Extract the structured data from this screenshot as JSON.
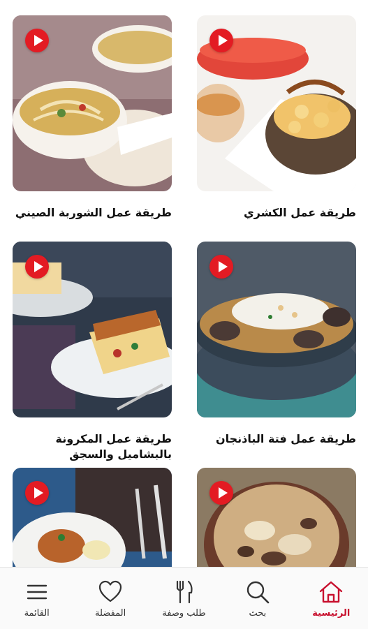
{
  "colors": {
    "accent": "#e31b23",
    "active_nav": "#c8102e",
    "nav_inactive": "#333333"
  },
  "recipes": [
    {
      "title": "طريقة عمل الكشري",
      "image": "koshari-photo",
      "play_icon": "play-icon"
    },
    {
      "title": "طريقة عمل الشوربة الصيني",
      "image": "chinese-soup-photo",
      "play_icon": "play-icon"
    },
    {
      "title": "طريقة عمل فتة الباذنجان",
      "image": "eggplant-fatteh-photo",
      "play_icon": "play-icon"
    },
    {
      "title": "طريقة عمل المكرونة بالبشاميل والسجق",
      "image": "bechamel-pasta-photo",
      "play_icon": "play-icon"
    },
    {
      "title": "",
      "image": "baked-dish-photo",
      "play_icon": "play-icon"
    },
    {
      "title": "",
      "image": "plated-meal-photo",
      "play_icon": "play-icon"
    }
  ],
  "bottom_nav": {
    "items": [
      {
        "label": "الرئيسية",
        "icon": "home-icon",
        "active": true
      },
      {
        "label": "بحث",
        "icon": "search-icon",
        "active": false
      },
      {
        "label": "طلب وصفة",
        "icon": "fork-knife-icon",
        "active": false
      },
      {
        "label": "المفضلة",
        "icon": "heart-icon",
        "active": false
      },
      {
        "label": "القائمة",
        "icon": "menu-icon",
        "active": false
      }
    ]
  }
}
